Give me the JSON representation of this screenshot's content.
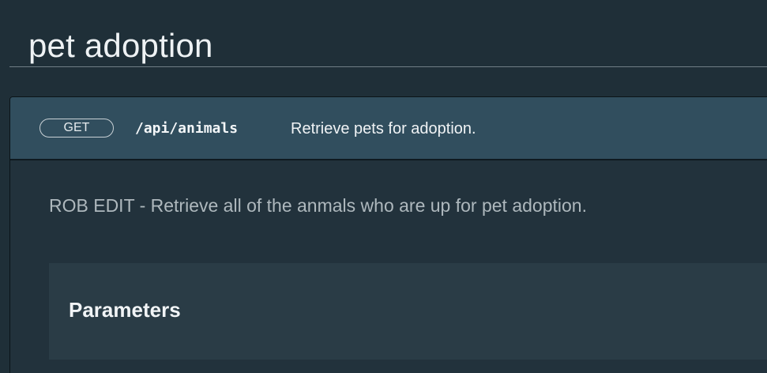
{
  "page": {
    "title": "pet adoption"
  },
  "operation": {
    "method": "GET",
    "path": "/api/animals",
    "summary": "Retrieve pets for adoption.",
    "description": "ROB EDIT - Retrieve all of the anmals who are up for pet adoption."
  },
  "parameters": {
    "heading": "Parameters"
  }
}
